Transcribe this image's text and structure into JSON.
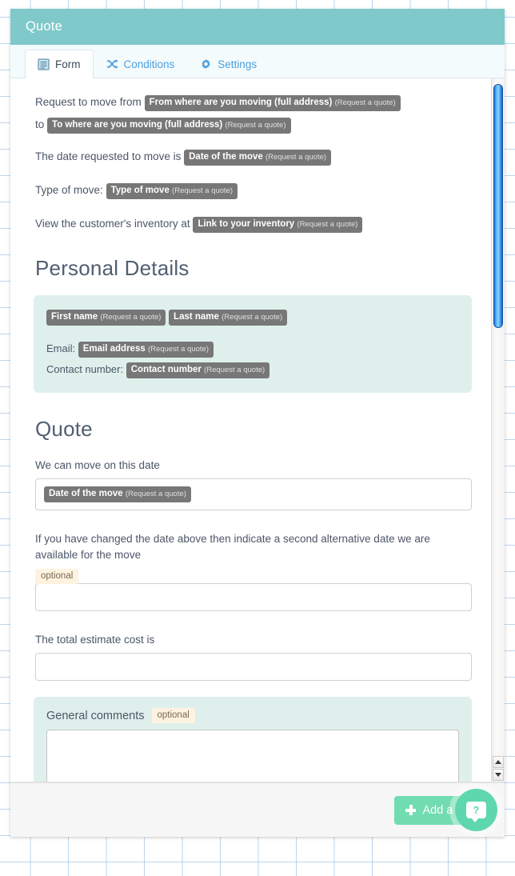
{
  "window": {
    "title": "Quote"
  },
  "tabs": [
    {
      "label": "Form",
      "icon": "document-lines-icon",
      "active": true
    },
    {
      "label": "Conditions",
      "icon": "shuffle-icon",
      "active": false
    },
    {
      "label": "Settings",
      "icon": "gear-icon",
      "active": false
    }
  ],
  "form": {
    "line1_prefix": "Request to move from",
    "token_from": "From where are you moving (full address)",
    "line1_mid": "to",
    "token_to": "To where are you moving (full address)",
    "line2_prefix": "The date requested to move is",
    "token_date": "Date of the move",
    "line3_prefix": "Type of move:",
    "token_typeofmove": "Type of move",
    "line4_prefix": "View the customer's inventory at",
    "token_inventory": "Link to your inventory",
    "token_suffix": "(Request a quote)"
  },
  "personal": {
    "heading": "Personal Details",
    "token_first": "First name",
    "token_last": "Last name",
    "email_label": "Email:",
    "token_email": "Email address",
    "contact_label": "Contact number:",
    "token_contact": "Contact number"
  },
  "quote": {
    "heading": "Quote",
    "date_label": "We can move on this date",
    "date_token": "Date of the move",
    "alt_label": "If you have changed the date above then indicate a second alternative date we are available for the move",
    "alt_optional": "optional",
    "alt_value": "",
    "cost_label": "The total estimate cost is",
    "cost_value": "",
    "comments_title": "General comments",
    "comments_optional": "optional",
    "comments_value": ""
  },
  "footer": {
    "add_label": "Add a new",
    "help_glyph": "?"
  },
  "colors": {
    "titlebar": "#7fc9ca",
    "token": "#777777",
    "mint_panel": "#dff0ec",
    "optional_badge": "#fdf3e0",
    "add_button": "#71dcb0",
    "help_fab": "#5fd7ae",
    "tab_link": "#4a9fe0",
    "heading": "#515e72"
  }
}
